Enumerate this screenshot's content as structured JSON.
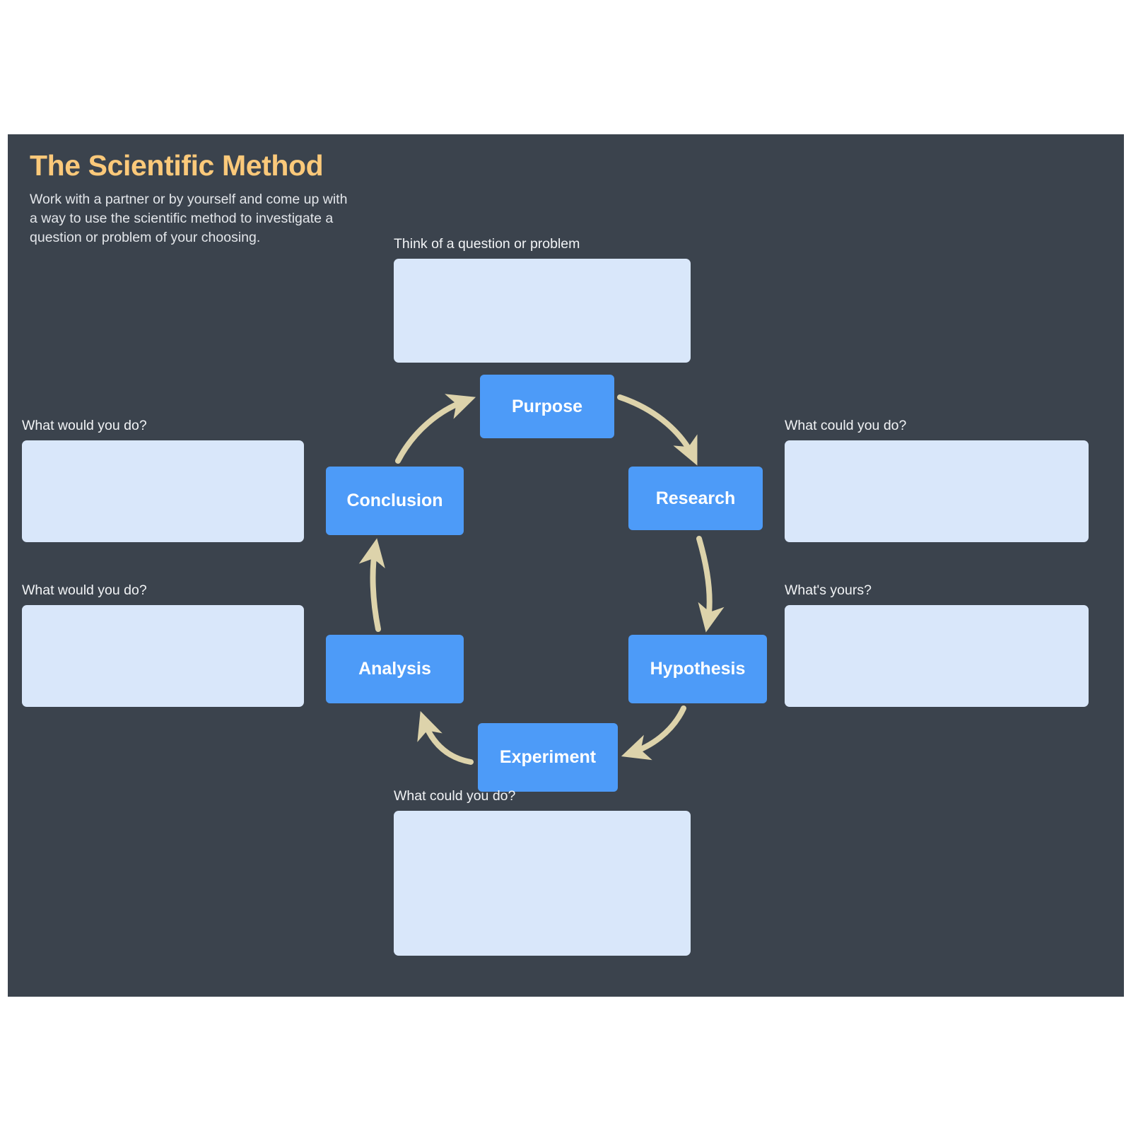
{
  "header": {
    "title": "The Scientific Method",
    "subtitle": "Work with a partner or by yourself and come up with a way to use the scientific method to investigate a question or problem of your choosing."
  },
  "theme": {
    "canvas_bg": "#3b434d",
    "title_color": "#fbc97a",
    "node_color": "#4d9bf8",
    "field_color": "#d9e7fa",
    "arrow_color": "#ddd3ab",
    "text_color": "#f2f4f6"
  },
  "cycle": {
    "nodes": [
      {
        "id": "purpose",
        "label": "Purpose"
      },
      {
        "id": "research",
        "label": "Research"
      },
      {
        "id": "hypothesis",
        "label": "Hypothesis"
      },
      {
        "id": "experiment",
        "label": "Experiment"
      },
      {
        "id": "analysis",
        "label": "Analysis"
      },
      {
        "id": "conclusion",
        "label": "Conclusion"
      }
    ],
    "flow": "purpose -> research -> hypothesis -> experiment -> analysis -> conclusion -> purpose"
  },
  "fields": {
    "top": {
      "label": "Think of a question or problem",
      "value": "",
      "placeholder": ""
    },
    "right_1": {
      "label": "What could you do?",
      "value": "",
      "placeholder": ""
    },
    "right_2": {
      "label": "What's yours?",
      "value": "",
      "placeholder": ""
    },
    "left_1": {
      "label": "What would you do?",
      "value": "",
      "placeholder": ""
    },
    "left_2": {
      "label": "What would you do?",
      "value": "",
      "placeholder": ""
    },
    "bottom": {
      "label": "What could you do?",
      "value": "",
      "placeholder": ""
    }
  }
}
